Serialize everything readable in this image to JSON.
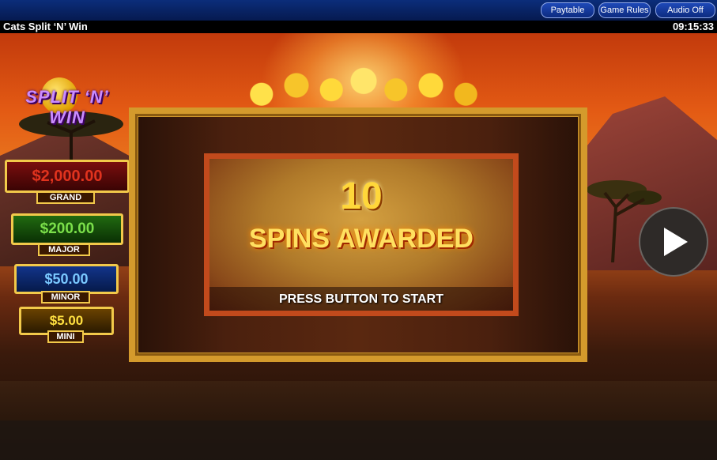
{
  "topbar": {
    "buttons": [
      "Paytable",
      "Game Rules",
      "Audio Off"
    ]
  },
  "titlebar": {
    "title": "Cats Split ‘N’ Win",
    "clock": "09:15:33"
  },
  "logo": {
    "text": "SPLIT ‘N’ WIN"
  },
  "jackpots": [
    {
      "amount": "$2,000.00",
      "label": "GRAND",
      "color": "#e0331e",
      "bg": "#6a0a0a"
    },
    {
      "amount": "$200.00",
      "label": "MAJOR",
      "color": "#7be04a",
      "bg": "#1a5a0a"
    },
    {
      "amount": "$50.00",
      "label": "MINOR",
      "color": "#7ac8ff",
      "bg": "#0a2a6a"
    },
    {
      "amount": "$5.00",
      "label": "MINI",
      "color": "#ffe040",
      "bg": "#5a3a00"
    }
  ],
  "bonus": {
    "count": "10",
    "awarded": "SPINS AWARDED",
    "prompt": "PRESS BUTTON TO START"
  },
  "play_button": {
    "icon": "play-icon"
  }
}
